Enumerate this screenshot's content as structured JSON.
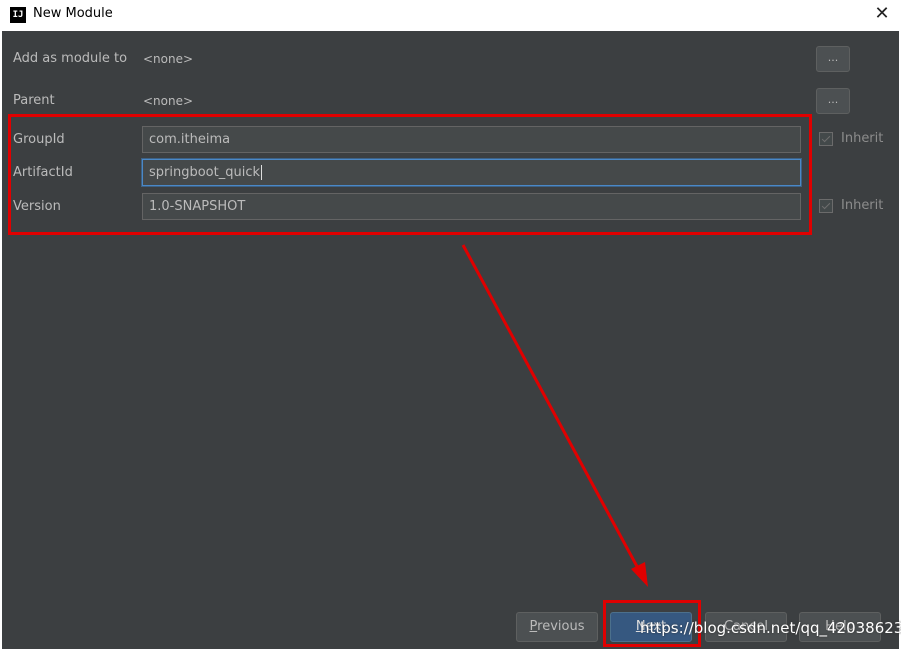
{
  "window": {
    "title": "New Module",
    "app_icon": "IJ"
  },
  "form": {
    "add_as_module_label": "Add as module to",
    "add_as_module_value": "<none>",
    "parent_label": "Parent",
    "parent_value": "<none>",
    "browse_label": "...",
    "groupid_label": "GroupId",
    "groupid_value": "com.itheima",
    "artifactid_label": "ArtifactId",
    "artifactid_value": "springboot_quick",
    "version_label": "Version",
    "version_value": "1.0-SNAPSHOT",
    "inherit_label": "Inherit",
    "groupid_inherit_checked": true,
    "version_inherit_checked": true
  },
  "buttons": {
    "previous": {
      "mnemonic": "P",
      "rest": "revious"
    },
    "next": {
      "mnemonic": "N",
      "rest": "ext"
    },
    "cancel": "Cancel",
    "help": "Help"
  },
  "watermark": "https://blog.csdn.net/qq_42038623",
  "colors": {
    "dialog_bg": "#3c3f41",
    "annotation": "#e00000",
    "primary_button": "#365880",
    "focus_border": "#4a88c7"
  },
  "icons": {
    "close": "close-icon",
    "app": "intellij-icon",
    "annotation_arrow": "arrow-icon"
  }
}
